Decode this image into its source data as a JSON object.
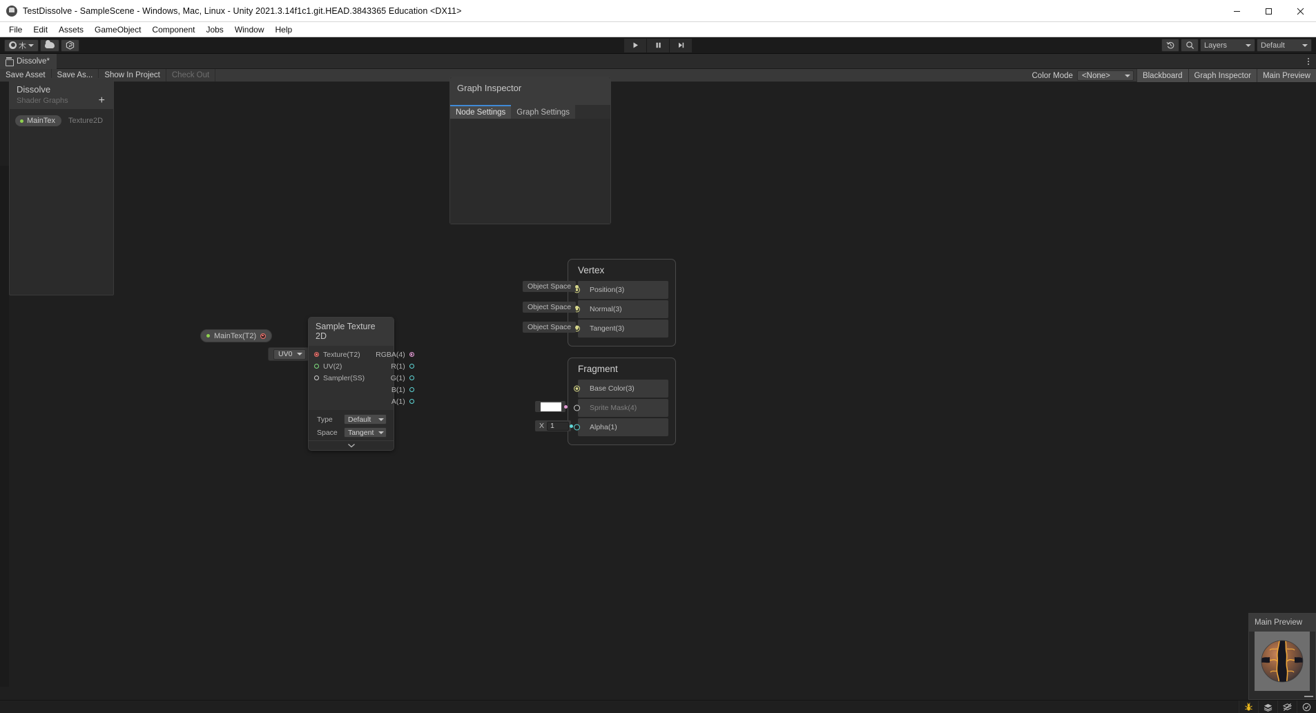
{
  "window": {
    "title": "TestDissolve - SampleScene - Windows, Mac, Linux - Unity 2021.3.14f1c1.git.HEAD.3843365 Education <DX11>",
    "minimize": "minimize-icon",
    "maximize": "maximize-icon",
    "close": "close-icon"
  },
  "menubar": {
    "items": [
      "File",
      "Edit",
      "Assets",
      "GameObject",
      "Component",
      "Jobs",
      "Window",
      "Help"
    ]
  },
  "unity_toolbar": {
    "account_label": "木",
    "cloud_icon": "cloud-icon",
    "collab_icon": "collab-icon",
    "play": "play-icon",
    "pause": "pause-icon",
    "step": "step-icon",
    "history_icon": "history-icon",
    "search_icon": "search-icon",
    "layers_label": "Layers",
    "layout_label": "Default"
  },
  "shadergraph_tab": {
    "label": "Dissolve*",
    "icon": "shader-graph-icon",
    "kebab": "more-options-icon"
  },
  "sg_toolbar": {
    "left_buttons": [
      {
        "label": "Save Asset",
        "disabled": false
      },
      {
        "label": "Save As...",
        "disabled": false
      },
      {
        "label": "Show In Project",
        "disabled": false
      },
      {
        "label": "Check Out",
        "disabled": true
      }
    ],
    "color_mode_label": "Color Mode",
    "color_mode_value": "<None>",
    "toggles": [
      "Blackboard",
      "Graph Inspector",
      "Main Preview"
    ]
  },
  "blackboard": {
    "title": "Dissolve",
    "subtitle": "Shader Graphs",
    "add_label": "+",
    "properties": [
      {
        "name": "MainTex",
        "type": "Texture2D"
      }
    ]
  },
  "graph_inspector": {
    "title": "Graph Inspector",
    "tabs": [
      {
        "label": "Node Settings",
        "active": true
      },
      {
        "label": "Graph Settings",
        "active": false
      }
    ]
  },
  "nodes": {
    "maintex_property": {
      "label": "MainTex(T2)"
    },
    "uv_node": {
      "value": "UV0"
    },
    "sample_texture_2d": {
      "title": "Sample Texture 2D",
      "inputs": [
        {
          "label": "Texture(T2)",
          "kind": "tex"
        },
        {
          "label": "UV(2)",
          "kind": "uv"
        },
        {
          "label": "Sampler(SS)",
          "kind": "white"
        }
      ],
      "outputs": [
        {
          "label": "RGBA(4)",
          "kind": "pink"
        },
        {
          "label": "R(1)",
          "kind": "cyan"
        },
        {
          "label": "G(1)",
          "kind": "cyan"
        },
        {
          "label": "B(1)",
          "kind": "cyan"
        },
        {
          "label": "A(1)",
          "kind": "cyan"
        }
      ],
      "settings": [
        {
          "label": "Type",
          "value": "Default"
        },
        {
          "label": "Space",
          "value": "Tangent"
        }
      ],
      "expander": "chevron-down-icon"
    },
    "vertex": {
      "title": "Vertex",
      "blocks": [
        {
          "label": "Position(3)",
          "widget": "Object Space",
          "port": "filled"
        },
        {
          "label": "Normal(3)",
          "widget": "Object Space",
          "port": "filled"
        },
        {
          "label": "Tangent(3)",
          "widget": "Object Space",
          "port": "filled"
        }
      ]
    },
    "fragment": {
      "title": "Fragment",
      "blocks": [
        {
          "label": "Base Color(3)",
          "widget": null,
          "port": "filled"
        },
        {
          "label": "Sprite Mask(4)",
          "widget": "color",
          "color": "#ffffff",
          "port": "pink"
        },
        {
          "label": "Alpha(1)",
          "widget": "number",
          "axis": "X",
          "value": "1",
          "port": "cyan"
        }
      ]
    }
  },
  "main_preview": {
    "title": "Main Preview"
  },
  "statusbar": {
    "icons": [
      "ant-icon",
      "layers-icon",
      "no-sync-icon",
      "check-circle-icon"
    ]
  },
  "colors": {
    "accent_blue": "#3f8ad8",
    "wire_pink": "#e39ad4",
    "wire_yellow": "#d6d68a",
    "wire_red": "#f4756f",
    "wire_green": "#7fe07f",
    "prop_green": "#8fd14f"
  }
}
